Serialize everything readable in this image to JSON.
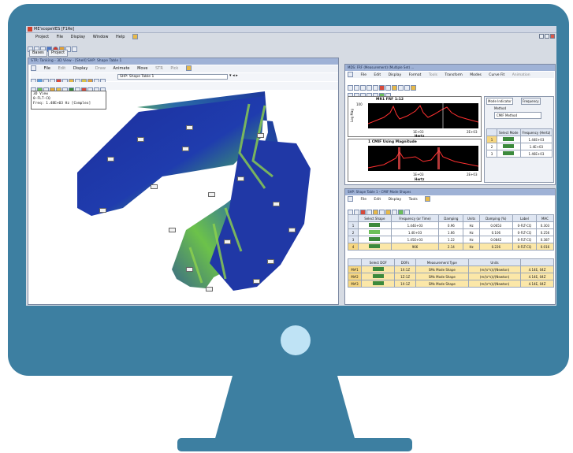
{
  "app": {
    "title": "ME'scopeVES [F1Re]",
    "menu": [
      "Project",
      "File",
      "Display",
      "Window",
      "Help"
    ],
    "tabs": [
      "Bases",
      "Project"
    ]
  },
  "left_window": {
    "title": "STR: Tanking - 3D View - [Shell] SHP: Shape Table 1",
    "menu": [
      "File",
      "Edit",
      "Display",
      "Draw",
      "Animate",
      "Move",
      "STR",
      "Pick"
    ],
    "shape_select": "SHP: Shape Table 1",
    "info_lines": [
      "3D View",
      "0-FLT-CQ",
      "Freq: 1.48E+03 Hz [Complex]"
    ],
    "axis_label": "X"
  },
  "frf_window": {
    "title": "MDS: FRF (Measurement) (Multiple Set) ...",
    "menu": [
      "File",
      "Edit",
      "Display",
      "Format",
      "Tools",
      "Transform",
      "Modes",
      "Curve Fit",
      "Animation"
    ],
    "plot1_title": "MR1 FRF 1:12",
    "plot1_ylabel": "Log Mag",
    "plot1_y_top": "100",
    "plot1_xlabel": "Hertz",
    "plot1_x_mid": "1E+03",
    "plot1_x_right": "2E+03",
    "plot2_title": "1 CMIF Using Magnitude",
    "plot2_xlabel": "Hertz",
    "plot2_x_mid": "1E+03",
    "plot2_x_right": "2E+03",
    "side_tabs": [
      "Mode Indicator",
      "Frequency"
    ],
    "method_label": "Method",
    "method_value": "CMIF Method",
    "side_table_headers": [
      "Select Mode",
      "Frequency (Hertz)"
    ],
    "side_table_rows": [
      {
        "n": "1",
        "freq": "1.44E+03"
      },
      {
        "n": "2",
        "freq": "1.4E+03"
      },
      {
        "n": "3",
        "freq": "1.46E+03"
      }
    ]
  },
  "shape_window": {
    "title": "SHP: Shape Table 1 - CMIF Mode Shapes",
    "menu": [
      "File",
      "Edit",
      "Display",
      "Tools"
    ],
    "table_headers": [
      "Select Shape",
      "Frequency (or Time)",
      "Damping",
      "Units",
      "Damping (%)",
      "Label",
      "MAC"
    ],
    "rows": [
      {
        "n": "1",
        "freq": "1.44E+03",
        "damping": "0.96",
        "units": "Hz",
        "pct": "0.0653",
        "label": "0-FLT-CQ",
        "mac": "0.303"
      },
      {
        "n": "2",
        "freq": "1.4E+03",
        "damping": "1.66",
        "units": "Hz",
        "pct": "0.106",
        "label": "0-FLT-CQ",
        "mac": "0.256"
      },
      {
        "n": "3",
        "freq": "1.45E+03",
        "damping": "1.22",
        "units": "Hz",
        "pct": "0.0842",
        "label": "0-FLT-CQ",
        "mac": "0.387"
      },
      {
        "n": "4",
        "freq": "966",
        "damping": "2.14",
        "units": "Hz",
        "pct": "0.226",
        "label": "0-FLT-CQ",
        "mac": "0.016"
      }
    ],
    "dof_headers": [
      "Select DOF",
      "DOFs",
      "Measurement Type",
      "Units",
      ""
    ],
    "dof_rows": [
      {
        "id": "M#1",
        "dofs": "1X:1Z",
        "type": "SMs Mode Shape",
        "units": "(m/(s*s))/(Newton)",
        "extra": "4.14E, 04Z"
      },
      {
        "id": "M#2",
        "dofs": "1Z:1Z",
        "type": "SMs Mode Shape",
        "units": "(m/(s*s))/(Newton)",
        "extra": "4.14E, 04Z"
      },
      {
        "id": "M#3",
        "dofs": "1X:1Z",
        "type": "SMs Mode Shape",
        "units": "(m/(s*s))/(Newton)",
        "extra": "4.14E, 04Z"
      }
    ]
  },
  "colors": {
    "bezel": "#3d7fa1",
    "power": "#bfe3f5",
    "mesh_blue": "#1f3aa8",
    "mesh_green": "#79c24a",
    "plot_bg": "#000000",
    "trace": "#ff3030"
  }
}
